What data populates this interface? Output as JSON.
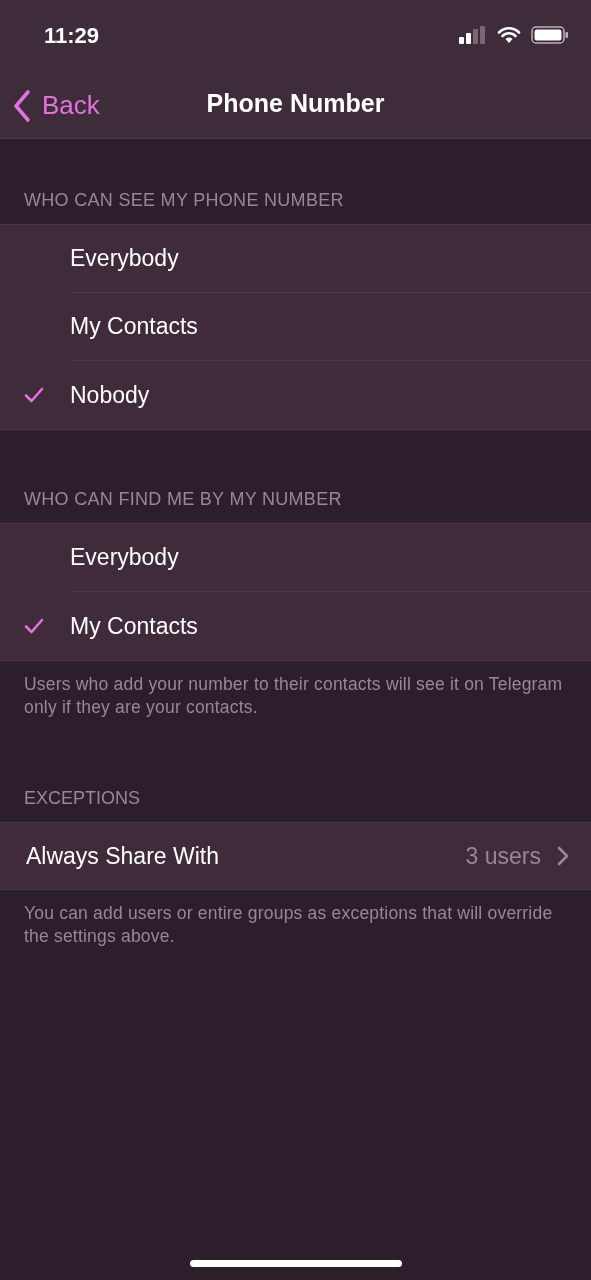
{
  "status_bar": {
    "time": "11:29"
  },
  "nav": {
    "back": "Back",
    "title": "Phone Number"
  },
  "sections": [
    {
      "header": "WHO CAN SEE MY PHONE NUMBER",
      "options": [
        {
          "label": "Everybody",
          "selected": false
        },
        {
          "label": "My Contacts",
          "selected": false
        },
        {
          "label": "Nobody",
          "selected": true
        }
      ]
    },
    {
      "header": "WHO CAN FIND ME BY MY NUMBER",
      "options": [
        {
          "label": "Everybody",
          "selected": false
        },
        {
          "label": "My Contacts",
          "selected": true
        }
      ],
      "footer": "Users who add your number to their contacts will see it on Telegram only if they are your contacts."
    }
  ],
  "exceptions": {
    "header": "EXCEPTIONS",
    "rows": [
      {
        "label": "Always Share With",
        "value": "3 users"
      }
    ],
    "footer": "You can add users or entire groups as exceptions that will override the settings above."
  }
}
